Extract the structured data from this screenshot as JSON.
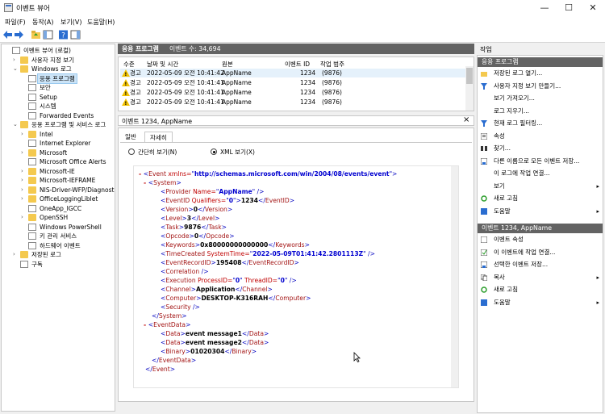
{
  "window": {
    "title": "이벤트 뷰어"
  },
  "menubar": [
    "파일(F)",
    "동작(A)",
    "보기(V)",
    "도움말(H)"
  ],
  "tree": [
    {
      "label": "이벤트 뷰어 (로컬)",
      "level": 0,
      "arrow": "",
      "icon": "log",
      "selected": false
    },
    {
      "label": "사용자 지정 보기",
      "level": 1,
      "arrow": "›",
      "icon": "folder",
      "selected": false
    },
    {
      "label": "Windows 로그",
      "level": 1,
      "arrow": "⌄",
      "icon": "folder",
      "selected": false
    },
    {
      "label": "응용 프로그램",
      "level": 2,
      "arrow": "",
      "icon": "log",
      "selected": true
    },
    {
      "label": "보안",
      "level": 2,
      "arrow": "",
      "icon": "log",
      "selected": false
    },
    {
      "label": "Setup",
      "level": 2,
      "arrow": "",
      "icon": "log",
      "selected": false
    },
    {
      "label": "시스템",
      "level": 2,
      "arrow": "",
      "icon": "log",
      "selected": false
    },
    {
      "label": "Forwarded Events",
      "level": 2,
      "arrow": "",
      "icon": "log",
      "selected": false
    },
    {
      "label": "응용 프로그램 및 서비스 로그",
      "level": 1,
      "arrow": "⌄",
      "icon": "folder",
      "selected": false
    },
    {
      "label": "Intel",
      "level": 2,
      "arrow": "›",
      "icon": "folder",
      "selected": false
    },
    {
      "label": "Internet Explorer",
      "level": 2,
      "arrow": "",
      "icon": "log",
      "selected": false
    },
    {
      "label": "Microsoft",
      "level": 2,
      "arrow": "›",
      "icon": "folder",
      "selected": false
    },
    {
      "label": "Microsoft Office Alerts",
      "level": 2,
      "arrow": "",
      "icon": "log",
      "selected": false
    },
    {
      "label": "Microsoft-IE",
      "level": 2,
      "arrow": "›",
      "icon": "folder",
      "selected": false
    },
    {
      "label": "Microsoft-IEFRAME",
      "level": 2,
      "arrow": "›",
      "icon": "folder",
      "selected": false
    },
    {
      "label": "NIS-Driver-WFP/Diagnostic",
      "level": 2,
      "arrow": "›",
      "icon": "folder",
      "selected": false
    },
    {
      "label": "OfficeLoggingLiblet",
      "level": 2,
      "arrow": "›",
      "icon": "folder",
      "selected": false
    },
    {
      "label": "OneApp_IGCC",
      "level": 2,
      "arrow": "",
      "icon": "log",
      "selected": false
    },
    {
      "label": "OpenSSH",
      "level": 2,
      "arrow": "›",
      "icon": "folder",
      "selected": false
    },
    {
      "label": "Windows PowerShell",
      "level": 2,
      "arrow": "",
      "icon": "log",
      "selected": false
    },
    {
      "label": "키 관리 서비스",
      "level": 2,
      "arrow": "",
      "icon": "log",
      "selected": false
    },
    {
      "label": "하드웨어 이벤트",
      "level": 2,
      "arrow": "",
      "icon": "log",
      "selected": false
    },
    {
      "label": "저장된 로그",
      "level": 1,
      "arrow": "›",
      "icon": "folder",
      "selected": false
    },
    {
      "label": "구독",
      "level": 1,
      "arrow": "",
      "icon": "log",
      "selected": false
    }
  ],
  "center": {
    "title": "응용 프로그램",
    "event_count": "이벤트 수: 34,694",
    "columns": [
      "수준",
      "날짜 및 시간",
      "원본",
      "이벤트 ID",
      "작업 범주"
    ],
    "rows": [
      {
        "level": "경고",
        "datetime": "2022-05-09 오전 10:41:42",
        "source": "AppName",
        "id": "1234",
        "category": "(9876)"
      },
      {
        "level": "경고",
        "datetime": "2022-05-09 오전 10:41:41",
        "source": "AppName",
        "id": "1234",
        "category": "(9876)"
      },
      {
        "level": "경고",
        "datetime": "2022-05-09 오전 10:41:41",
        "source": "AppName",
        "id": "1234",
        "category": "(9876)"
      },
      {
        "level": "경고",
        "datetime": "2022-05-09 오전 10:41:41",
        "source": "AppName",
        "id": "1234",
        "category": "(9876)"
      }
    ],
    "detail_title": "이벤트 1234, AppName",
    "close": "×",
    "tabs": [
      "일반",
      "자세히"
    ],
    "radio_friendly": "간단히 보기(N)",
    "radio_xml": "XML 보기(X)"
  },
  "xml": {
    "ns": "http://schemas.microsoft.com/win/2004/08/events/event",
    "provider_name": "AppName",
    "qualifiers": "0",
    "event_id": "1234",
    "version": "0",
    "level": "3",
    "task": "9876",
    "opcode": "0",
    "keywords": "0x80000000000000",
    "time_created": "2022-05-09T01:41:42.2801113Z",
    "record_id": "195408",
    "process_id": "0",
    "thread_id": "0",
    "channel": "Application",
    "computer": "DESKTOP-K316RAH",
    "data1": "event message1",
    "data2": "event message2",
    "binary": "01020304"
  },
  "actions": {
    "header": "작업",
    "sec1": "응용 프로그램",
    "items1": [
      {
        "label": "저장된 로그 열기...",
        "icon": "folder-open-icon",
        "sub": ""
      },
      {
        "label": "사용자 지정 보기 만들기...",
        "icon": "filter-icon",
        "sub": ""
      },
      {
        "label": "보기 가져오기...",
        "icon": "",
        "sub": ""
      },
      {
        "label": "로그 지우기...",
        "icon": "",
        "sub": ""
      },
      {
        "label": "현재 로그 필터링...",
        "icon": "filter-icon",
        "sub": ""
      },
      {
        "label": "속성",
        "icon": "properties-icon",
        "sub": ""
      },
      {
        "label": "찾기...",
        "icon": "find-icon",
        "sub": ""
      },
      {
        "label": "다른 이름으로 모든 이벤트 저장...",
        "icon": "save-icon",
        "sub": ""
      },
      {
        "label": "이 로그에 작업 연결...",
        "icon": "",
        "sub": ""
      },
      {
        "label": "보기",
        "icon": "",
        "sub": "▸"
      },
      {
        "label": "새로 고침",
        "icon": "refresh-icon",
        "sub": ""
      },
      {
        "label": "도움말",
        "icon": "help-icon",
        "sub": "▸"
      }
    ],
    "sec2": "이벤트 1234, AppName",
    "items2": [
      {
        "label": "이벤트 속성",
        "icon": "event-properties-icon",
        "sub": ""
      },
      {
        "label": "이 이벤트에 작업 연결...",
        "icon": "task-icon",
        "sub": ""
      },
      {
        "label": "선택한 이벤트 저장...",
        "icon": "save-icon",
        "sub": ""
      },
      {
        "label": "복사",
        "icon": "copy-icon",
        "sub": "▸"
      },
      {
        "label": "새로 고침",
        "icon": "refresh-icon",
        "sub": ""
      },
      {
        "label": "도움말",
        "icon": "help-icon",
        "sub": "▸"
      }
    ]
  }
}
